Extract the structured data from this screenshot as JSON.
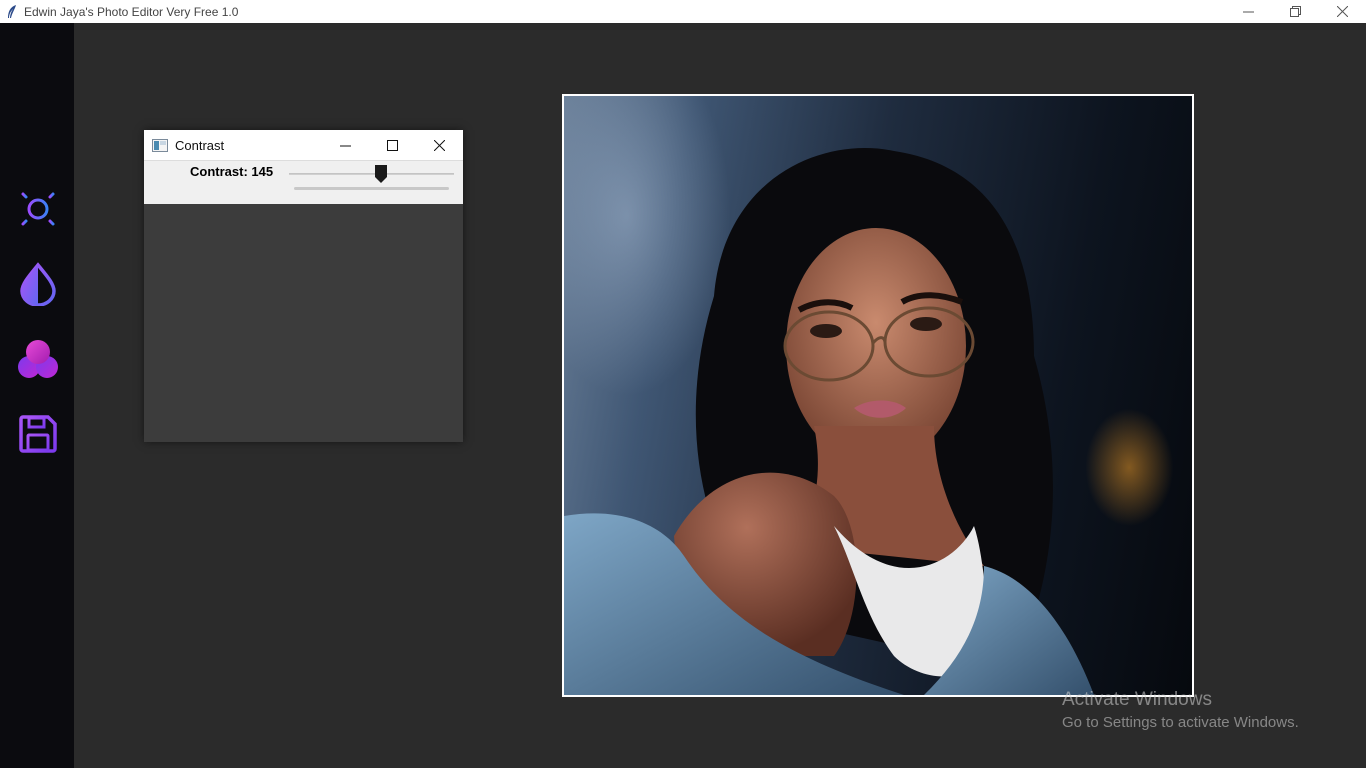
{
  "window": {
    "title": "Edwin Jaya's Photo Editor Very Free 1.0",
    "app_icon": "feather-icon",
    "controls": [
      "minimize-icon",
      "restore-icon",
      "close-icon"
    ]
  },
  "sidebar": {
    "tools": [
      {
        "name": "brightness",
        "icon": "sun-icon"
      },
      {
        "name": "contrast",
        "icon": "drop-icon"
      },
      {
        "name": "color",
        "icon": "color-circles-icon"
      },
      {
        "name": "save",
        "icon": "floppy-disk-icon"
      }
    ],
    "accent_colors": [
      "#8b5cf6",
      "#c026d3",
      "#3b82f6"
    ]
  },
  "dialog": {
    "title": "Contrast",
    "label": "Contrast: 145",
    "slider_fraction": 0.56,
    "controls": [
      "minimize-icon",
      "maximize-icon",
      "close-icon"
    ]
  },
  "photo": {
    "description_icon": "portrait-photo"
  },
  "watermark": {
    "line1": "Activate Windows",
    "line2": "Go to Settings to activate Windows."
  }
}
